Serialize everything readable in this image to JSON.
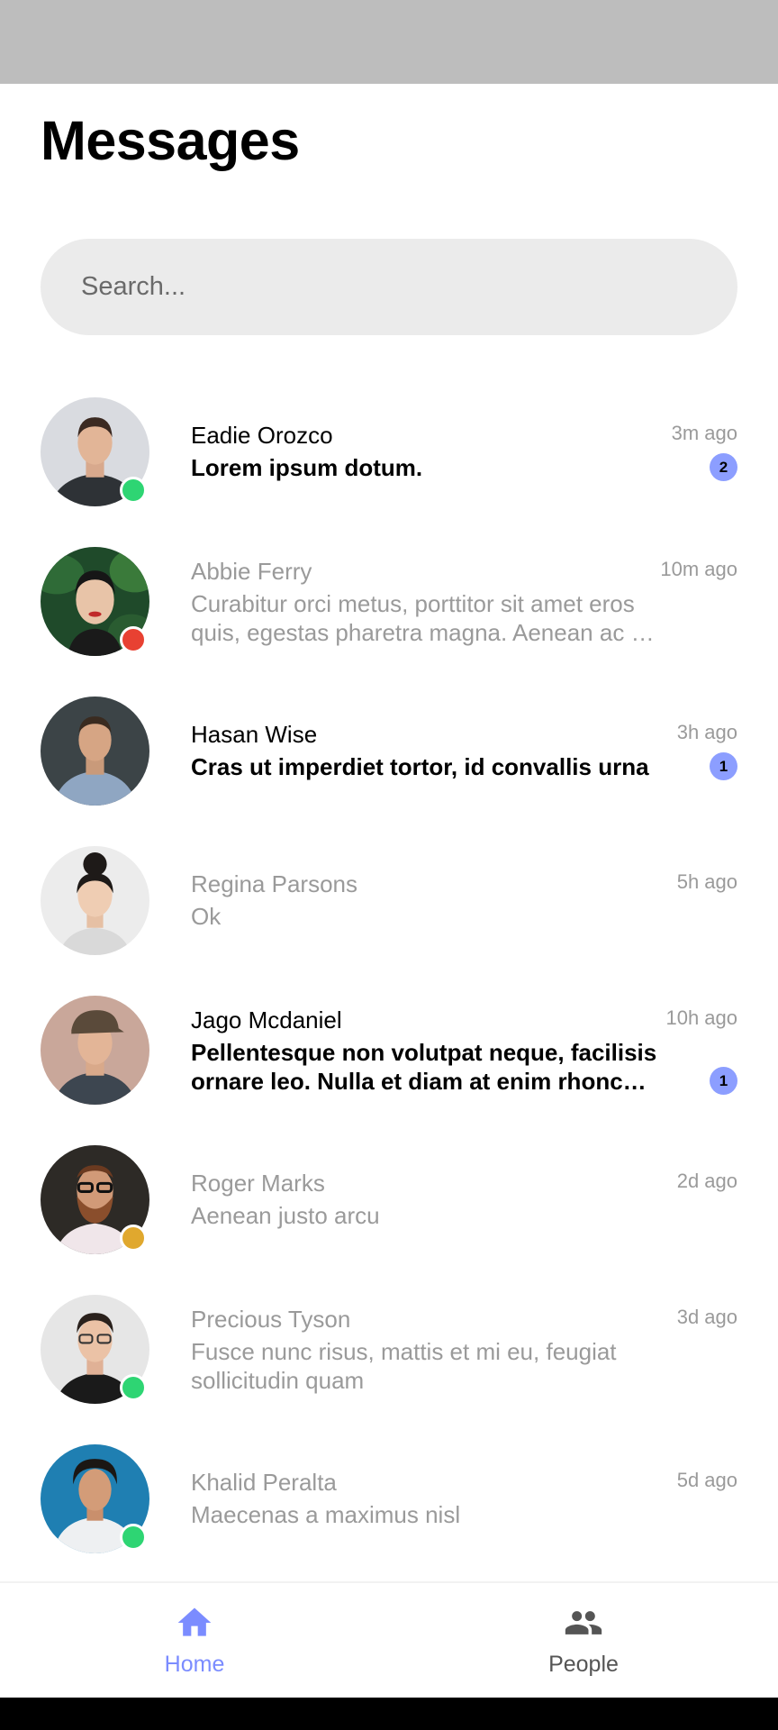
{
  "header": {
    "title": "Messages"
  },
  "search": {
    "placeholder": "Search..."
  },
  "conversations": [
    {
      "name": "Eadie Orozco",
      "preview": "Lorem ipsum dotum.",
      "time": "3m ago",
      "unread": "2",
      "status": "online"
    },
    {
      "name": "Abbie Ferry",
      "preview": "Curabitur orci metus, porttitor sit amet eros quis, egestas pharetra magna. Aenean ac mi luctus, nec tincidunt",
      "time": "10m ago",
      "unread": "",
      "status": "busy"
    },
    {
      "name": "Hasan Wise",
      "preview": "Cras ut imperdiet tortor, id convallis urna",
      "time": "3h ago",
      "unread": "1",
      "status": "none"
    },
    {
      "name": "Regina Parsons",
      "preview": "Ok",
      "time": "5h ago",
      "unread": "",
      "status": "none"
    },
    {
      "name": "Jago Mcdaniel",
      "preview": "Pellentesque non volutpat neque, facilisis ornare leo. Nulla et diam at enim rhoncus vehicula",
      "time": "10h ago",
      "unread": "1",
      "status": "none"
    },
    {
      "name": "Roger Marks",
      "preview": "Aenean justo arcu",
      "time": "2d ago",
      "unread": "",
      "status": "away"
    },
    {
      "name": "Precious Tyson",
      "preview": "Fusce nunc risus, mattis et mi eu, feugiat sollicitudin quam",
      "time": "3d ago",
      "unread": "",
      "status": "online"
    },
    {
      "name": "Khalid Peralta",
      "preview": "Maecenas a maximus nisl",
      "time": "5d ago",
      "unread": "",
      "status": "online"
    }
  ],
  "bottom_nav": {
    "home": {
      "label": "Home",
      "icon": "home-icon"
    },
    "people": {
      "label": "People",
      "icon": "people-icon"
    }
  },
  "colors": {
    "accent": "#7b8cff",
    "badge": "#8c9eff",
    "online": "#2ed573",
    "busy": "#e84132",
    "away": "#e0a82e",
    "status_bar": "#bdbdbd"
  }
}
